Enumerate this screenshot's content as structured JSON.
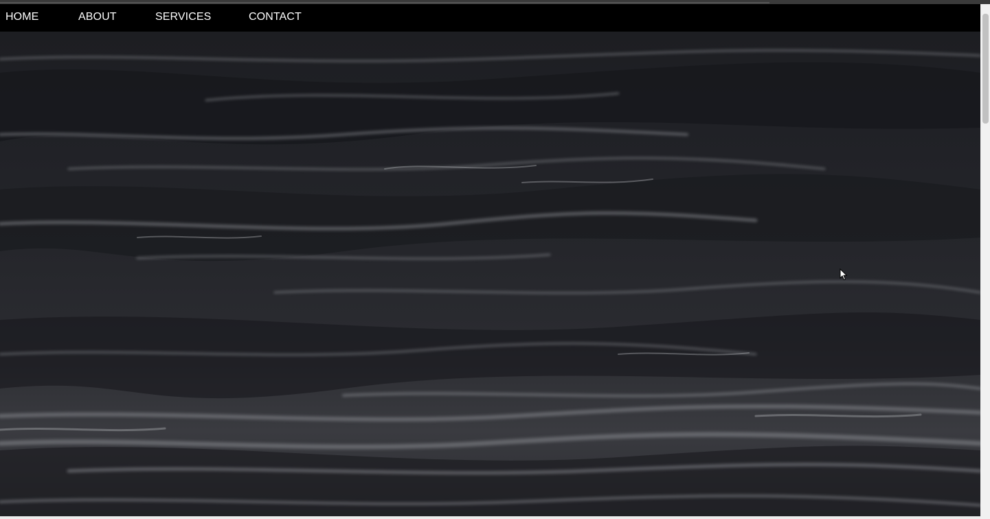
{
  "nav": {
    "home": "HOME",
    "about": "ABOUT",
    "services": "SERVICES",
    "contact": "CONTACT"
  },
  "hero": {
    "image": "dark-ocean-waves"
  },
  "colors": {
    "nav_bg": "#000000",
    "nav_text": "#ffffff",
    "scrollbar_track": "#f1f1f1",
    "scrollbar_thumb": "#c1c1c1"
  }
}
